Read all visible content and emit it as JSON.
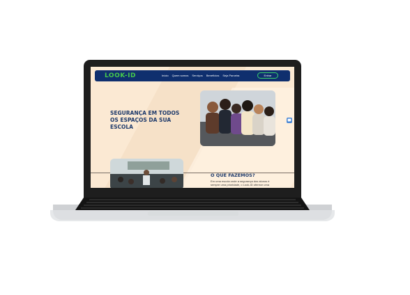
{
  "site": {
    "logo_text": "LOOK-ID",
    "nav_items": [
      "Início",
      "Quem somos",
      "Serviços",
      "Benefícios",
      "Seja Parceira"
    ],
    "enter_button": "Entrar",
    "hero_title": "SEGURANÇA EM TODOS OS ESPAÇOS DA SUA ESCOLA",
    "about_title": "O QUE FAZEMOS?",
    "about_text": "Em uma escola onde a segurança dos alunos é sempre uma prioridade, o Look-ID oferece uma"
  },
  "colors": {
    "nav_bg": "#0f2f6e",
    "accent_green": "#3bd36b",
    "page_bg": "#fbe9d3",
    "title_blue": "#1e3a6b"
  },
  "icons": [
    "chat-icon"
  ]
}
